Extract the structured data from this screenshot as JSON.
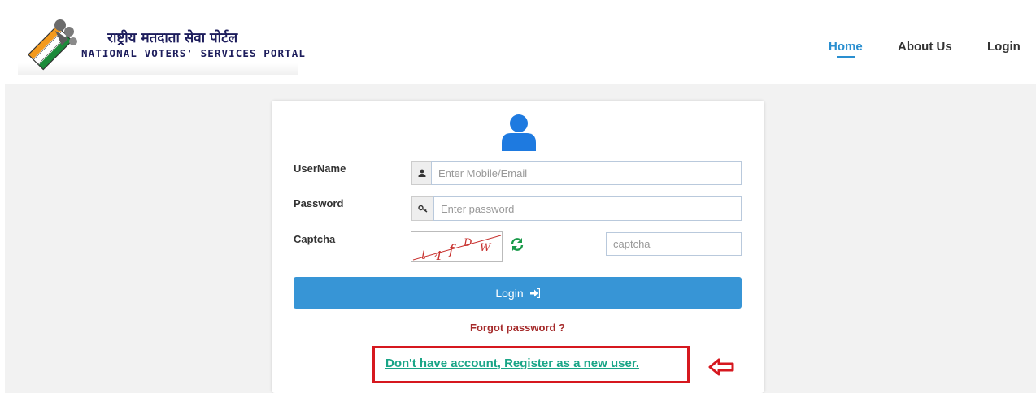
{
  "header": {
    "brand_hindi": "राष्ट्रीय मतदाता सेवा पोर्टल",
    "brand_english": "NATIONAL VOTERS' SERVICES PORTAL",
    "logo_icon": "eci-voters-logo-icon",
    "nav": [
      {
        "label": "Home",
        "active": true
      },
      {
        "label": "About Us",
        "active": false
      },
      {
        "label": "Login",
        "active": false
      }
    ]
  },
  "login_form": {
    "avatar_icon": "user-icon",
    "username": {
      "label": "UserName",
      "placeholder": "Enter Mobile/Email",
      "icon": "user-small-icon"
    },
    "password": {
      "label": "Password",
      "placeholder": "Enter password",
      "icon": "key-icon"
    },
    "captcha": {
      "label": "Captcha",
      "image_text": "t4fDW",
      "placeholder": "captcha",
      "refresh_icon": "refresh-icon"
    },
    "submit_label": "Login",
    "submit_icon": "sign-in-icon",
    "forgot_password": "Forgot password ?",
    "register_link": "Don't have account, Register as a new user."
  },
  "annotation": {
    "highlight_color": "#d6181f",
    "arrow_icon": "left-arrow-icon"
  },
  "colors": {
    "accent": "#2a8fd0",
    "button": "#3795d6",
    "forgot": "#a52a2a",
    "register": "#1aa587",
    "brand": "#1d1d5c"
  }
}
